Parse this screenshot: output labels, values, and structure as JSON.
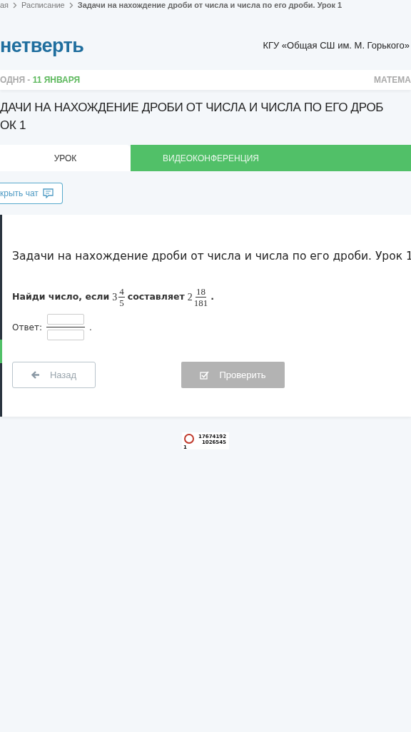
{
  "breadcrumb": [
    {
      "label": "ая",
      "current": false
    },
    {
      "label": "Расписание",
      "current": false
    },
    {
      "label": "Задачи на нахождение дроби от числа и числа по его дроби. Урок 1",
      "current": true
    }
  ],
  "header": {
    "logo": "нетверть",
    "school": "КГУ «Общая СШ им. М. Горького»"
  },
  "date_bar": {
    "prefix": "ОДНЯ -",
    "date": "11 ЯНВАРЯ",
    "subject": "МАТЕМА"
  },
  "lesson_title": [
    "ДАЧИ НА НАХОЖДЕНИЕ ДРОБИ ОТ ЧИСЛА И ЧИСЛА ПО ЕГО ДРОБ",
    "ОК 1"
  ],
  "tabs": [
    {
      "label": "УРОК",
      "selected": true
    },
    {
      "label": "ВИДЕОКОНФЕРЕНЦИЯ",
      "selected": false
    }
  ],
  "chat_button": "крыть чат",
  "task": {
    "title": "Задачи на нахождение дроби от числа и числа по его дроби. Урок 1",
    "question": {
      "text_before": "Найди число, если",
      "first": {
        "whole": "3",
        "numerator": "4",
        "denominator": "5"
      },
      "text_middle": "составляет",
      "second": {
        "whole": "2",
        "numerator": "18",
        "denominator": "181"
      },
      "text_end": "."
    },
    "answer_label": "Ответ:",
    "answer_end": "."
  },
  "buttons": [
    {
      "kind": "back",
      "label": "Назад"
    },
    {
      "kind": "check",
      "label": "Проверить",
      "disabled": true
    }
  ],
  "counter": {
    "line_1": "17674192",
    "line_2": "1026545",
    "line_3": "1"
  }
}
